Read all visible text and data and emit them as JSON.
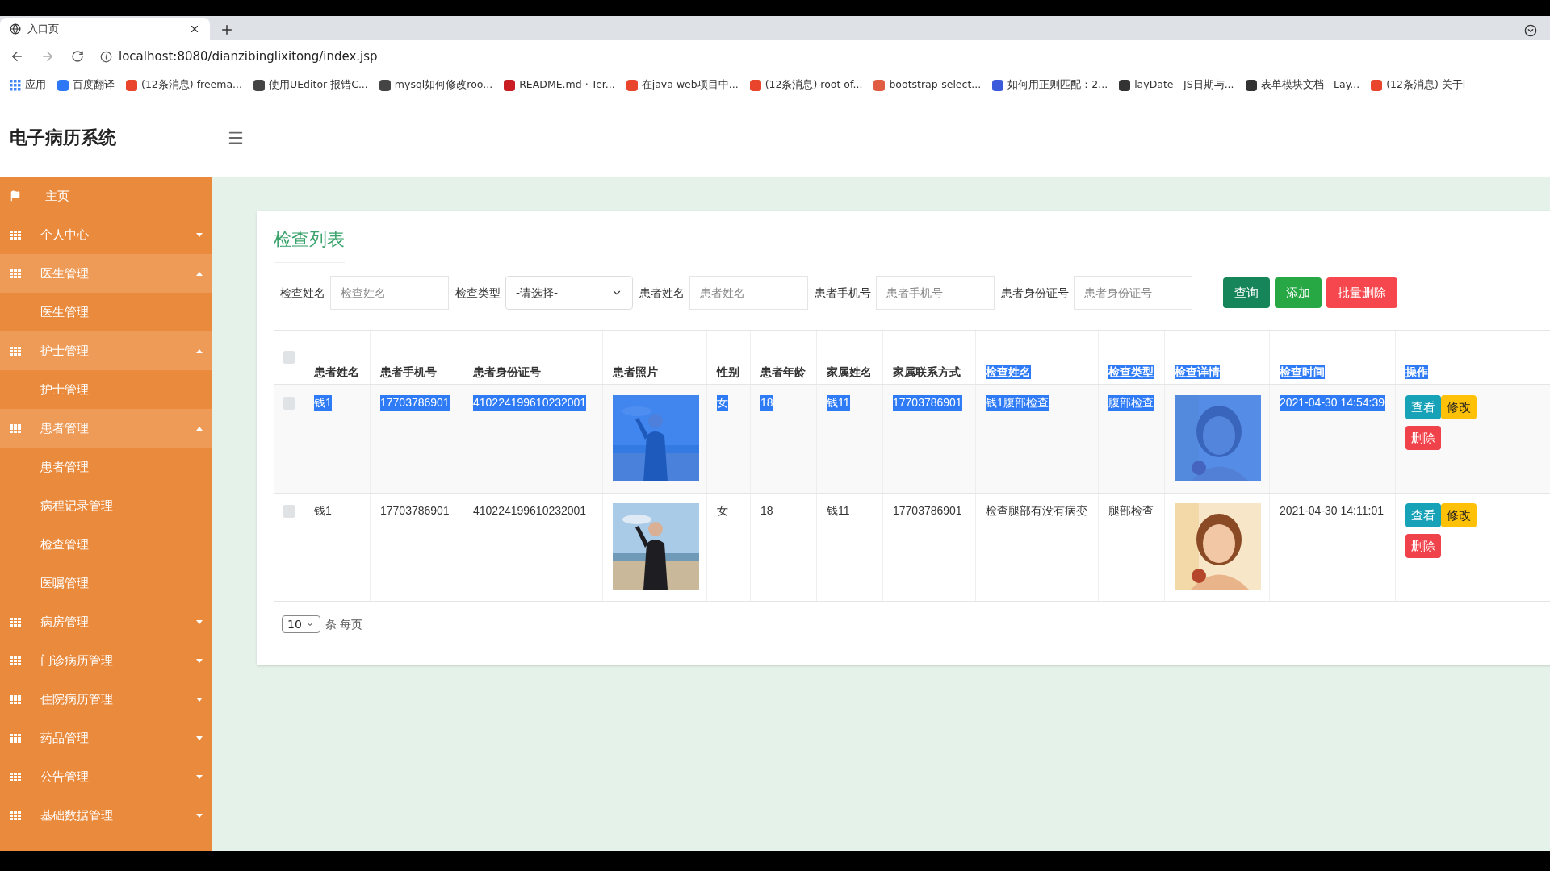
{
  "browser": {
    "tab_title": "入口页",
    "url": "localhost:8080/dianzibinglixitong/index.jsp",
    "bookmarks": [
      {
        "label": "应用",
        "color": "#4285f4",
        "kind": "apps"
      },
      {
        "label": "百度翻译",
        "color": "#2e77f5",
        "kind": "site"
      },
      {
        "label": "(12条消息) freema...",
        "color": "#e8452c",
        "kind": "site"
      },
      {
        "label": "使用UEditor 报错C...",
        "color": "#444444",
        "kind": "site"
      },
      {
        "label": "mysql如何修改roo...",
        "color": "#444444",
        "kind": "site"
      },
      {
        "label": "README.md · Ter...",
        "color": "#c71d23",
        "kind": "site"
      },
      {
        "label": "在java web项目中...",
        "color": "#e8452c",
        "kind": "site"
      },
      {
        "label": "(12条消息) root of...",
        "color": "#e8452c",
        "kind": "site"
      },
      {
        "label": "bootstrap-select...",
        "color": "#e05d44",
        "kind": "site"
      },
      {
        "label": "如何用正则匹配：2...",
        "color": "#3b5bdb",
        "kind": "site"
      },
      {
        "label": "layDate - JS日期与...",
        "color": "#333333",
        "kind": "site"
      },
      {
        "label": "表单模块文档 - Lay...",
        "color": "#333333",
        "kind": "site"
      },
      {
        "label": "(12条消息) 关于l",
        "color": "#e8452c",
        "kind": "site"
      }
    ]
  },
  "app_title": "电子病历系统",
  "sidebar": {
    "items": [
      {
        "label": "主页",
        "kind": "home"
      },
      {
        "label": "个人中心",
        "kind": "group",
        "expanded": false
      },
      {
        "label": "医生管理",
        "kind": "group",
        "expanded": true,
        "children": [
          {
            "label": "医生管理"
          }
        ]
      },
      {
        "label": "护士管理",
        "kind": "group",
        "expanded": true,
        "children": [
          {
            "label": "护士管理"
          }
        ]
      },
      {
        "label": "患者管理",
        "kind": "group",
        "expanded": true,
        "children": [
          {
            "label": "患者管理"
          },
          {
            "label": "病程记录管理"
          },
          {
            "label": "检查管理"
          },
          {
            "label": "医嘱管理"
          }
        ]
      },
      {
        "label": "病房管理",
        "kind": "group",
        "expanded": false
      },
      {
        "label": "门诊病历管理",
        "kind": "group",
        "expanded": false
      },
      {
        "label": "住院病历管理",
        "kind": "group",
        "expanded": false
      },
      {
        "label": "药品管理",
        "kind": "group",
        "expanded": false
      },
      {
        "label": "公告管理",
        "kind": "group",
        "expanded": false
      },
      {
        "label": "基础数据管理",
        "kind": "group",
        "expanded": false
      }
    ]
  },
  "page_title": "检查列表",
  "filters": [
    {
      "label": "检查姓名",
      "kind": "input",
      "placeholder": "检查姓名"
    },
    {
      "label": "检查类型",
      "kind": "select",
      "value": "-请选择-"
    },
    {
      "label": "患者姓名",
      "kind": "input",
      "placeholder": "患者姓名"
    },
    {
      "label": "患者手机号",
      "kind": "input",
      "placeholder": "患者手机号"
    },
    {
      "label": "患者身份证号",
      "kind": "input",
      "placeholder": "患者身份证号"
    }
  ],
  "buttons": [
    {
      "label": "查询",
      "kind": "query"
    },
    {
      "label": "添加",
      "kind": "add"
    },
    {
      "label": "批量删除",
      "kind": "delete"
    }
  ],
  "table": {
    "header_checked": false,
    "columns": [
      {
        "label": "患者姓名",
        "selected": false
      },
      {
        "label": "患者手机号",
        "selected": false
      },
      {
        "label": "患者身份证号",
        "selected": false
      },
      {
        "label": "患者照片",
        "selected": false
      },
      {
        "label": "性别",
        "selected": false
      },
      {
        "label": "患者年龄",
        "selected": false
      },
      {
        "label": "家属姓名",
        "selected": false
      },
      {
        "label": "家属联系方式",
        "selected": false
      },
      {
        "label": "检查姓名",
        "selected": true
      },
      {
        "label": "检查类型",
        "selected": true
      },
      {
        "label": "检查详情",
        "selected": true
      },
      {
        "label": "检查时间",
        "selected": true
      },
      {
        "label": "操作",
        "selected": true
      }
    ],
    "rows": [
      {
        "selected": true,
        "checked": false,
        "cells": [
          {
            "kind": "text",
            "text": "钱1"
          },
          {
            "kind": "text",
            "text": "17703786901"
          },
          {
            "kind": "text",
            "text": "410224199610232001"
          },
          {
            "kind": "picture"
          },
          {
            "kind": "text",
            "text": "女"
          },
          {
            "kind": "text",
            "text": "18"
          },
          {
            "kind": "text",
            "text": "钱11"
          },
          {
            "kind": "text",
            "text": "17703786901"
          },
          {
            "kind": "text",
            "text": "钱1腹部检查"
          },
          {
            "kind": "text",
            "text": "腹部检查"
          },
          {
            "kind": "picture"
          },
          {
            "kind": "text",
            "text": "2021-04-30 14:54:39"
          },
          {
            "kind": "actions",
            "actions": [
              {
                "label": "查看",
                "kind": "view"
              },
              {
                "label": "修改",
                "kind": "edit"
              },
              {
                "label": "删除",
                "kind": "delete"
              }
            ]
          }
        ]
      },
      {
        "selected": false,
        "checked": false,
        "cells": [
          {
            "kind": "text",
            "text": "钱1"
          },
          {
            "kind": "text",
            "text": "17703786901"
          },
          {
            "kind": "text",
            "text": "410224199610232001"
          },
          {
            "kind": "picture"
          },
          {
            "kind": "text",
            "text": "女"
          },
          {
            "kind": "text",
            "text": "18"
          },
          {
            "kind": "text",
            "text": "钱11"
          },
          {
            "kind": "text",
            "text": "17703786901"
          },
          {
            "kind": "text",
            "text": "检查腿部有没有病变"
          },
          {
            "kind": "text",
            "text": "腿部检查"
          },
          {
            "kind": "picture"
          },
          {
            "kind": "text",
            "text": "2021-04-30 14:11:01"
          },
          {
            "kind": "actions",
            "actions": [
              {
                "label": "查看",
                "kind": "view"
              },
              {
                "label": "修改",
                "kind": "edit"
              },
              {
                "label": "删除",
                "kind": "delete"
              }
            ]
          }
        ]
      }
    ]
  },
  "pagination": {
    "page_size": "10",
    "label": "条 每页"
  }
}
